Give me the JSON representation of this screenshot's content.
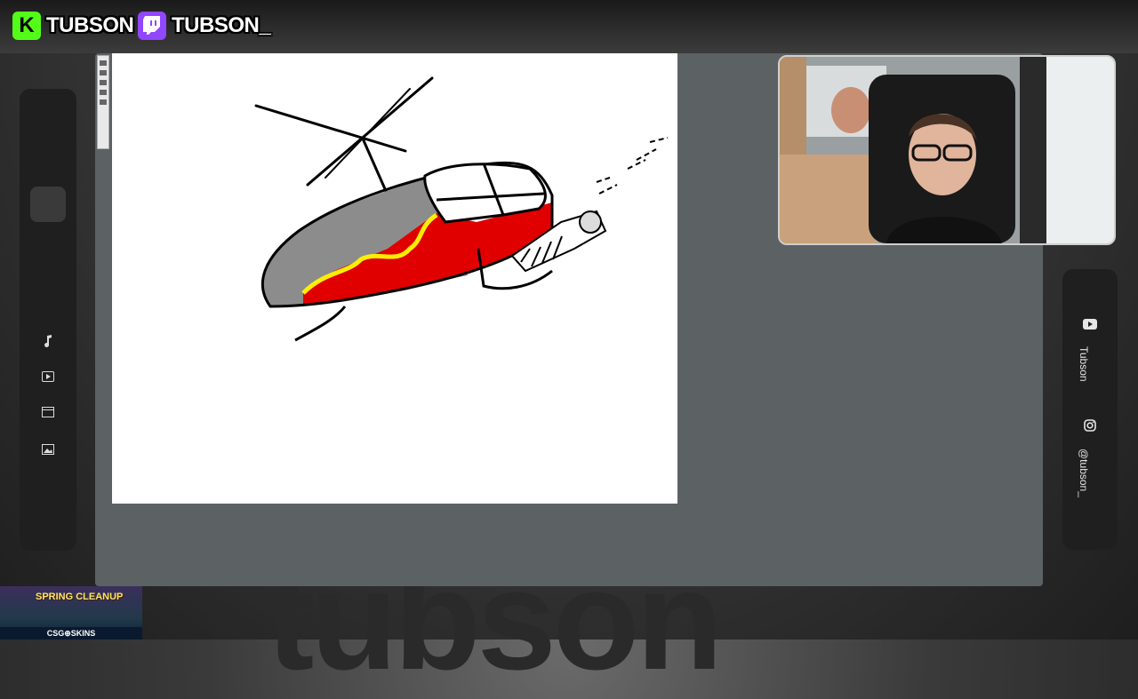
{
  "header": {
    "kick": {
      "name": "TUBSON",
      "logo": "K",
      "icon": "kick-logo-icon",
      "color": "#53fc18"
    },
    "twitch": {
      "name": "TUBSON_",
      "icon": "twitch-logo-icon",
      "color": "#9146ff"
    }
  },
  "sidebar": {
    "items": [
      {
        "icon": "music-note-icon"
      },
      {
        "icon": "play-box-icon"
      },
      {
        "icon": "clapperboard-icon"
      },
      {
        "icon": "image-icon"
      }
    ]
  },
  "socials": [
    {
      "icon": "youtube-icon",
      "label": "Tubson"
    },
    {
      "icon": "instagram-icon",
      "label": "@tubson_"
    }
  ],
  "watermark": "tubson",
  "promo": {
    "title": "SPRING CLEANUP",
    "brand": "CSG⊕SKINS"
  },
  "drawing": {
    "subject": "helicopter",
    "colors": {
      "body": "#8c8c8c",
      "flame_red": "#e00000",
      "flame_yellow": "#ffee00",
      "stroke": "#000000"
    }
  }
}
